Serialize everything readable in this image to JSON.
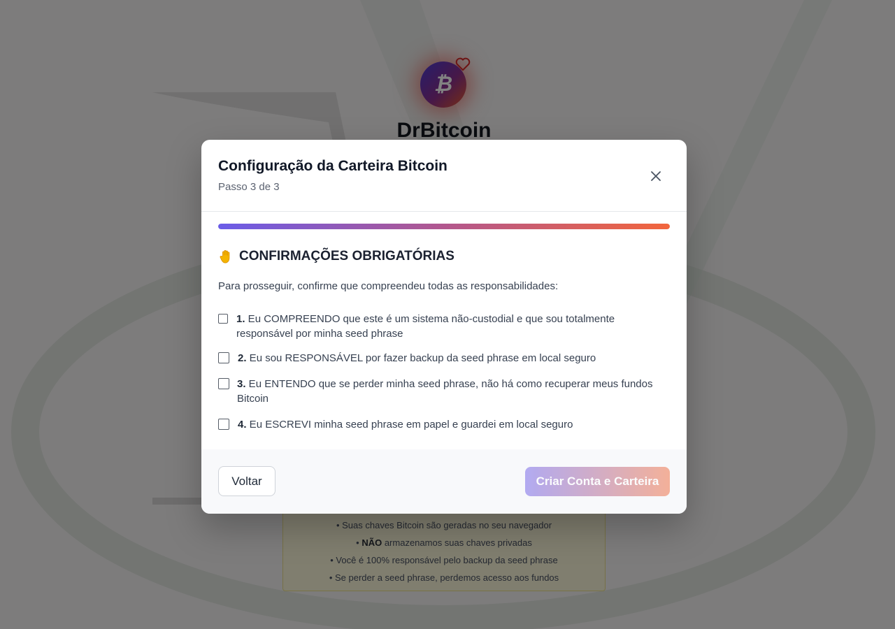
{
  "background": {
    "brand_name": "DrBitcoin",
    "logo_glyph": "₿",
    "info_lines": [
      {
        "bold": "",
        "text": "• Suas chaves Bitcoin são geradas no seu navegador"
      },
      {
        "bold": "NÃO",
        "prefix": "• ",
        "text": " armazenamos suas chaves privadas"
      },
      {
        "bold": "",
        "text": "• Você é 100% responsável pelo backup da seed phrase"
      },
      {
        "bold": "",
        "text": "• Se perder a seed phrase, perdemos acesso aos fundos"
      }
    ]
  },
  "modal": {
    "title": "Configuração da Carteira Bitcoin",
    "step": "Passo 3 de 3",
    "progress_percent": 100,
    "section_icon": "raised-hand-icon",
    "section_heading": "CONFIRMAÇÕES OBRIGATÓRIAS",
    "intro": "Para prosseguir, confirme que compreendeu todas as responsabilidades:",
    "confirmations": [
      {
        "number": "1.",
        "text": " Eu COMPREENDO que este é um sistema não-custodial e que sou totalmente responsável por minha seed phrase",
        "checked": false
      },
      {
        "number": "2.",
        "text": " Eu sou RESPONSÁVEL por fazer backup da seed phrase em local seguro",
        "checked": false
      },
      {
        "number": "3.",
        "text": " Eu ENTENDO que se perder minha seed phrase, não há como recuperar meus fundos Bitcoin",
        "checked": false
      },
      {
        "number": "4.",
        "text": " Eu ESCREVI minha seed phrase em papel e guardei em local seguro",
        "checked": false
      }
    ],
    "back_label": "Voltar",
    "create_label": "Criar Conta e Carteira",
    "create_disabled": true
  },
  "colors": {
    "progress_start": "#6a5ce8",
    "progress_end": "#f2653c",
    "overlay": "rgba(0,0,0,0.49)"
  }
}
